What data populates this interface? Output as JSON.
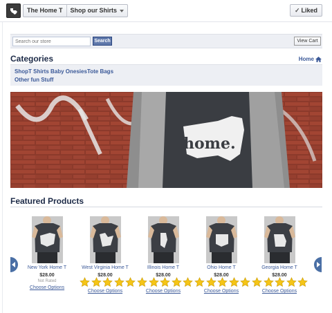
{
  "topbar": {
    "breadcrumb": [
      "The Home T",
      "Shop our Shirts"
    ],
    "liked_label": "Liked"
  },
  "search": {
    "placeholder": "Search our store",
    "button_label": "Search",
    "cart_label": "View Cart"
  },
  "categories": {
    "title": "Categories",
    "home_label": "Home",
    "row1": [
      "Shop",
      "T Shirts",
      "Baby Onesies",
      "Tote Bags"
    ],
    "row2": [
      "Other fun Stuff"
    ]
  },
  "hero": {
    "shirt_text": "home."
  },
  "featured": {
    "title": "Featured Products",
    "products": [
      {
        "name": "New York Home T",
        "price": "$28.00",
        "rating_text": "Not Rated",
        "options_label": "Choose Options"
      },
      {
        "name": "West Virginia Home T",
        "price": "$28.00",
        "options_label": "Choose Options"
      },
      {
        "name": "Illinois Home T",
        "price": "$28.00",
        "options_label": "Choose Options"
      },
      {
        "name": "Ohio Home T",
        "price": "$28.00",
        "options_label": "Choose Options"
      },
      {
        "name": "Georgia Home T",
        "price": "$28.00",
        "options_label": "Choose Options"
      }
    ],
    "star_count": 20
  },
  "colors": {
    "facebook_blue": "#3b5998",
    "star_yellow": "#f5c518",
    "brick_red": "#8a3325"
  }
}
